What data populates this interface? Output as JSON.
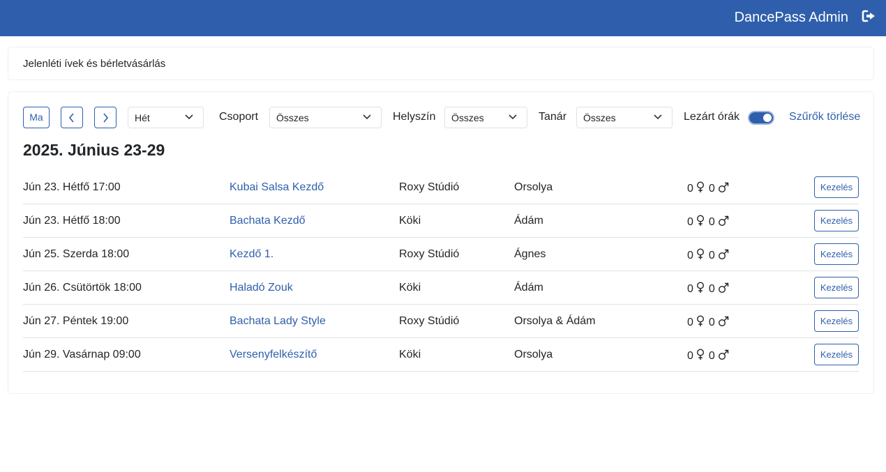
{
  "header": {
    "brand": "DancePass Admin",
    "logout_icon": "logout-icon",
    "bg_color": "#2f5fac"
  },
  "page": {
    "section_title": "Jelenléti ívek és bérletvásárlás"
  },
  "toolbar": {
    "today_label": "Ma",
    "prev_icon": "chevron-left-icon",
    "next_icon": "chevron-right-icon",
    "period_value": "Hét",
    "group_label": "Csoport",
    "group_value": "Összes",
    "location_label": "Helyszín",
    "location_value": "Összes",
    "teacher_label": "Tanár",
    "teacher_value": "Összes",
    "closed_label": "Lezárt órák",
    "closed_enabled": true,
    "clear_filters": "Szűrők törlése"
  },
  "week_title": "2025. Június 23-29",
  "sessions": [
    {
      "date": "Jún 23. Hétfő 17:00",
      "class": "Kubai Salsa Kezdő",
      "location": "Roxy Stúdió",
      "teacher": "Orsolya",
      "female": "0",
      "male": "0",
      "action": "Kezelés"
    },
    {
      "date": "Jún 23. Hétfő 18:00",
      "class": "Bachata Kezdő",
      "location": "Köki",
      "teacher": "Ádám",
      "female": "0",
      "male": "0",
      "action": "Kezelés"
    },
    {
      "date": "Jún 25. Szerda 18:00",
      "class": "Kezdő 1.",
      "location": "Roxy Stúdió",
      "teacher": "Ágnes",
      "female": "0",
      "male": "0",
      "action": "Kezelés"
    },
    {
      "date": "Jún 26. Csütörtök 18:00",
      "class": "Haladó Zouk",
      "location": "Köki",
      "teacher": "Ádám",
      "female": "0",
      "male": "0",
      "action": "Kezelés"
    },
    {
      "date": "Jún 27. Péntek 19:00",
      "class": "Bachata Lady Style",
      "location": "Roxy Stúdió",
      "teacher": "Orsolya & Ádám",
      "female": "0",
      "male": "0",
      "action": "Kezelés"
    },
    {
      "date": "Jún 29. Vasárnap 09:00",
      "class": "Versenyfelkészítő",
      "location": "Köki",
      "teacher": "Orsolya",
      "female": "0",
      "male": "0",
      "action": "Kezelés"
    }
  ]
}
